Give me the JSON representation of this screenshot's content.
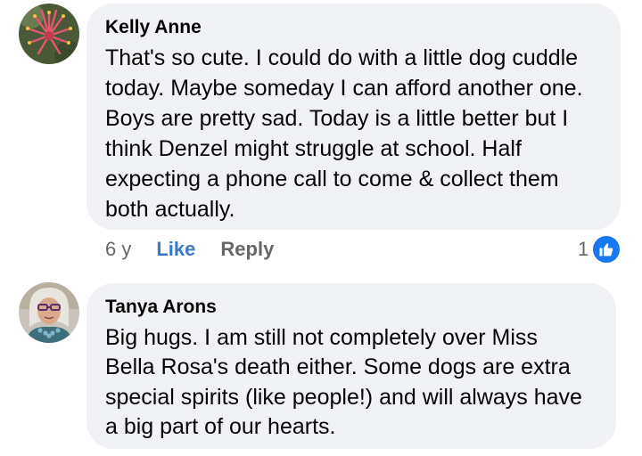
{
  "comments": [
    {
      "author": "Kelly Anne",
      "avatar": "flower-avatar",
      "lines": [
        "That's so cute. I could do with a little dog cuddle",
        "today. Maybe someday I can afford another one.",
        "Boys are pretty sad. Today is a little better but I",
        "think Denzel might struggle at school. Half",
        "expecting a phone call to come & collect them",
        "both actually."
      ],
      "time": "6 y",
      "like_label": "Like",
      "reply_label": "Reply",
      "reaction_count": "1",
      "reaction_icon": "thumbs-up-icon"
    },
    {
      "author": "Tanya Arons",
      "avatar": "woman-avatar",
      "lines": [
        "Big hugs.  I am still not completely over Miss",
        "Bella Rosa's death either.  Some dogs are extra",
        "special spirits (like people!) and will always have",
        "a big part of our hearts."
      ]
    }
  ],
  "colors": {
    "bubble": "#f0f2f5",
    "link": "#3a78c9",
    "muted": "#65676b",
    "like_badge": "#1877f2"
  }
}
